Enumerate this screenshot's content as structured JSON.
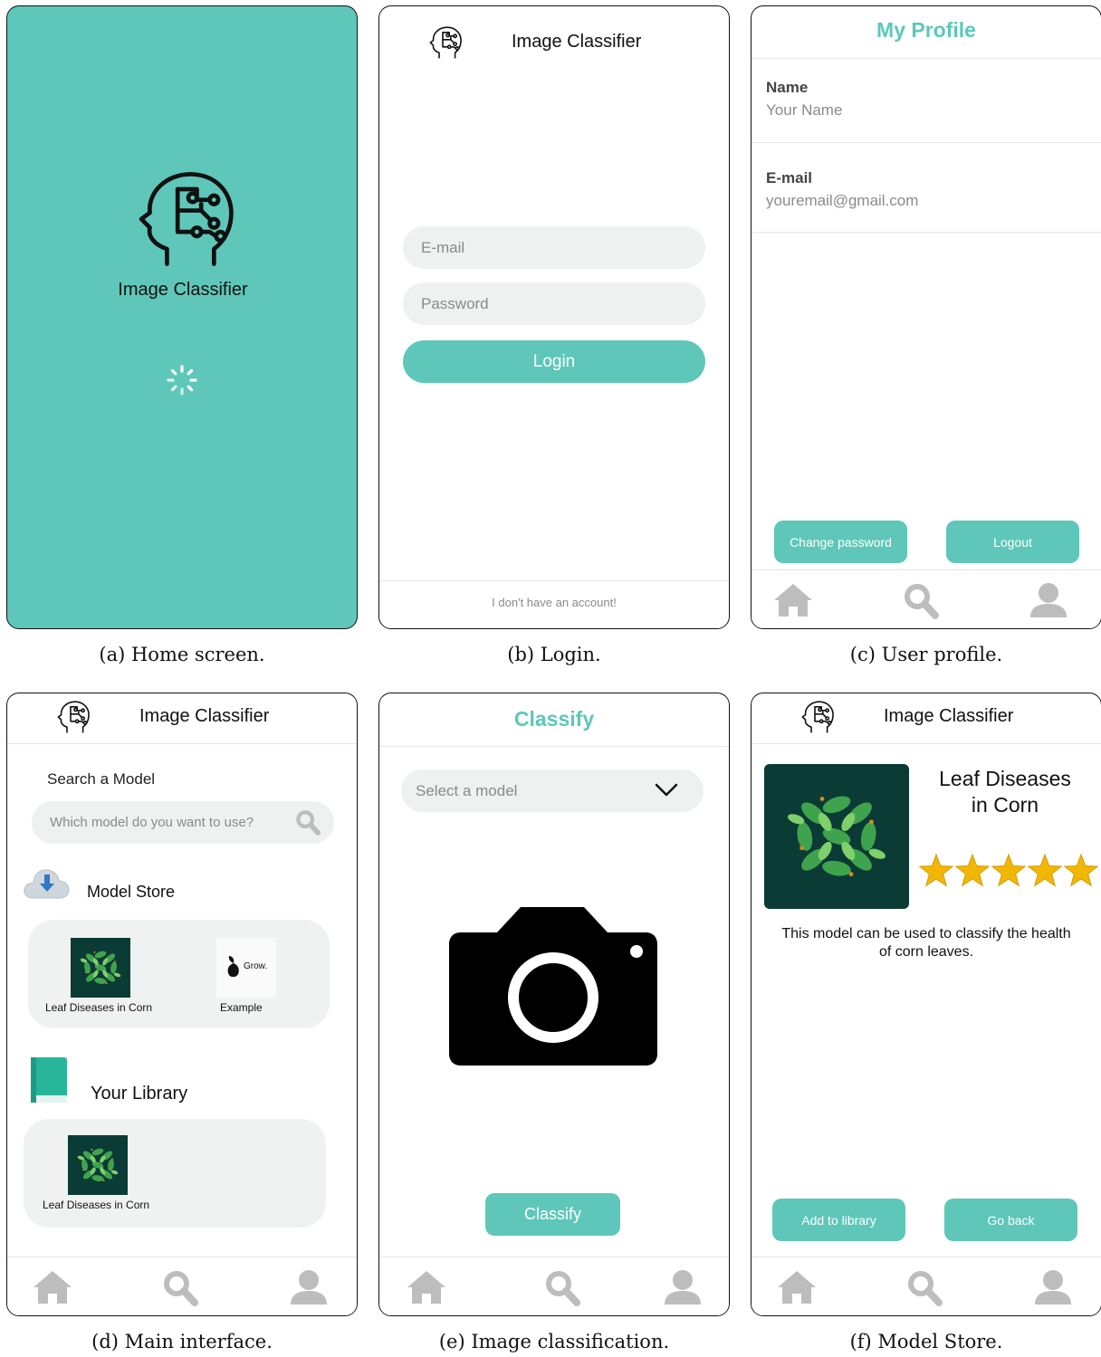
{
  "colors": {
    "accent": "#5ec7b9",
    "input_bg": "#eef1f0",
    "nav_icon": "#bdbdbd",
    "star": "#f2b705",
    "leaf_bg": "#0b3b35"
  },
  "panel_a": {
    "app_name": "Image Classifier",
    "caption": "(a) Home screen."
  },
  "panel_b": {
    "app_name": "Image Classifier",
    "email_placeholder": "E-mail",
    "password_placeholder": "Password",
    "login_label": "Login",
    "no_account_link": "I don't have an account!",
    "caption": "(b) Login."
  },
  "panel_c": {
    "title": "My Profile",
    "name_label": "Name",
    "name_value": "Your Name",
    "email_label": "E-mail",
    "email_value": "youremail@gmail.com",
    "change_password_label": "Change password",
    "logout_label": "Logout",
    "caption": "(c) User profile."
  },
  "panel_d": {
    "app_name": "Image Classifier",
    "search_heading": "Search a Model",
    "search_placeholder": "Which model do you want to use?",
    "store_heading": "Model Store",
    "store_items": [
      {
        "label": "Leaf Diseases in Corn",
        "icon": "leaf-model-icon"
      },
      {
        "label": "Example",
        "icon": "grow-logo-icon",
        "logo_text": "Grow."
      }
    ],
    "library_heading": "Your Library",
    "library_items": [
      {
        "label": "Leaf Diseases in Corn",
        "icon": "leaf-model-icon"
      }
    ],
    "caption": "(d) Main interface."
  },
  "panel_e": {
    "title": "Classify",
    "select_placeholder": "Select a model",
    "classify_label": "Classify",
    "caption": "(e) Image classification."
  },
  "panel_f": {
    "app_name": "Image Classifier",
    "model_title_line1": "Leaf Diseases",
    "model_title_line2": "in Corn",
    "rating_stars": 5,
    "description_line1": "This model can be used to classify the health",
    "description_line2": "of corn leaves.",
    "add_label": "Add to library",
    "back_label": "Go back",
    "caption": "(f) Model Store."
  }
}
